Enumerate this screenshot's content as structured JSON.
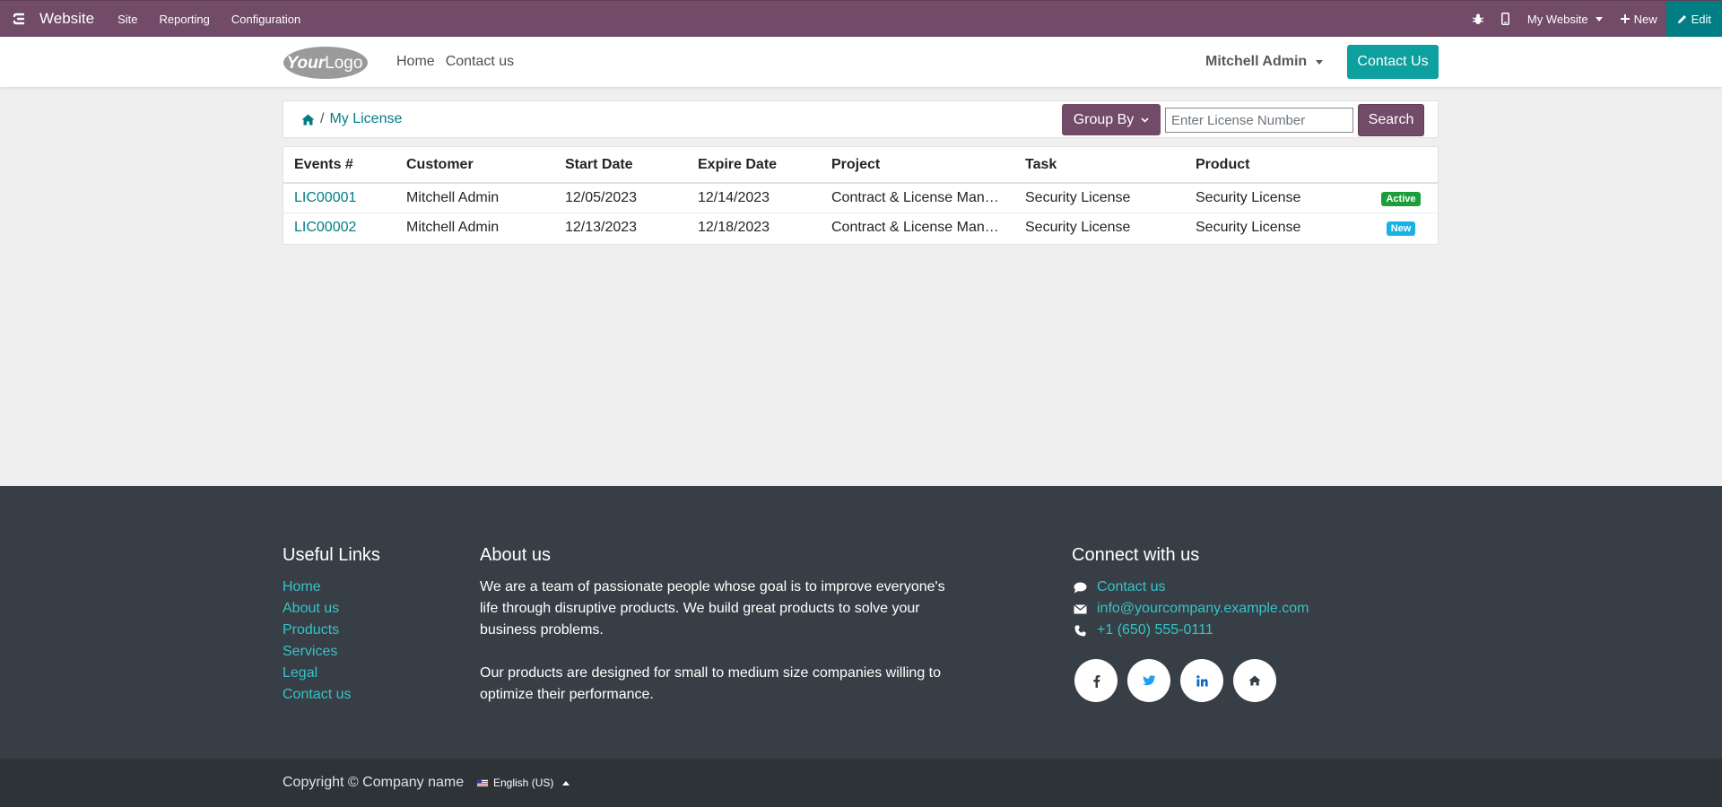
{
  "admin_bar": {
    "app_name": "Website",
    "menu": [
      "Site",
      "Reporting",
      "Configuration"
    ],
    "website_label": "My Website",
    "new_label": "New",
    "edit_label": "Edit"
  },
  "header": {
    "logo_text": "YourLogo",
    "nav": [
      "Home",
      "Contact us"
    ],
    "user": "Mitchell Admin",
    "contact_button": "Contact Us"
  },
  "breadcrumb": {
    "separator": "/",
    "current": "My License"
  },
  "search": {
    "group_by_label": "Group By",
    "placeholder": "Enter License Number",
    "button_label": "Search"
  },
  "table": {
    "columns": [
      "Events #",
      "Customer",
      "Start Date",
      "Expire Date",
      "Project",
      "Task",
      "Product",
      ""
    ],
    "rows": [
      {
        "number": "LIC00001",
        "customer": "Mitchell Admin",
        "start": "12/05/2023",
        "expire": "12/14/2023",
        "project": "Contract & License Management",
        "task": "Security License",
        "product": "Security License",
        "status": "Active"
      },
      {
        "number": "LIC00002",
        "customer": "Mitchell Admin",
        "start": "12/13/2023",
        "expire": "12/18/2023",
        "project": "Contract & License Management",
        "task": "Security License",
        "product": "Security License",
        "status": "New"
      }
    ]
  },
  "footer": {
    "useful_links_title": "Useful Links",
    "useful_links": [
      "Home",
      "About us",
      "Products",
      "Services",
      "Legal",
      "Contact us"
    ],
    "about_title": "About us",
    "about_p1": "We are a team of passionate people whose goal is to improve everyone's life through disruptive products. We build great products to solve your business problems.",
    "about_p2": "Our products are designed for small to medium size companies willing to optimize their performance.",
    "connect_title": "Connect with us",
    "connect_contact": "Contact us",
    "connect_email": "info@yourcompany.example.com",
    "connect_phone": "+1 (650) 555-0111",
    "socials": [
      "facebook-icon",
      "twitter-icon",
      "linkedin-icon",
      "home-icon"
    ]
  },
  "copyright": {
    "text": "Copyright © Company name",
    "language": "English (US)"
  },
  "colors": {
    "brand": "#714b67",
    "teal": "#017e84",
    "footer": "#383e45"
  }
}
